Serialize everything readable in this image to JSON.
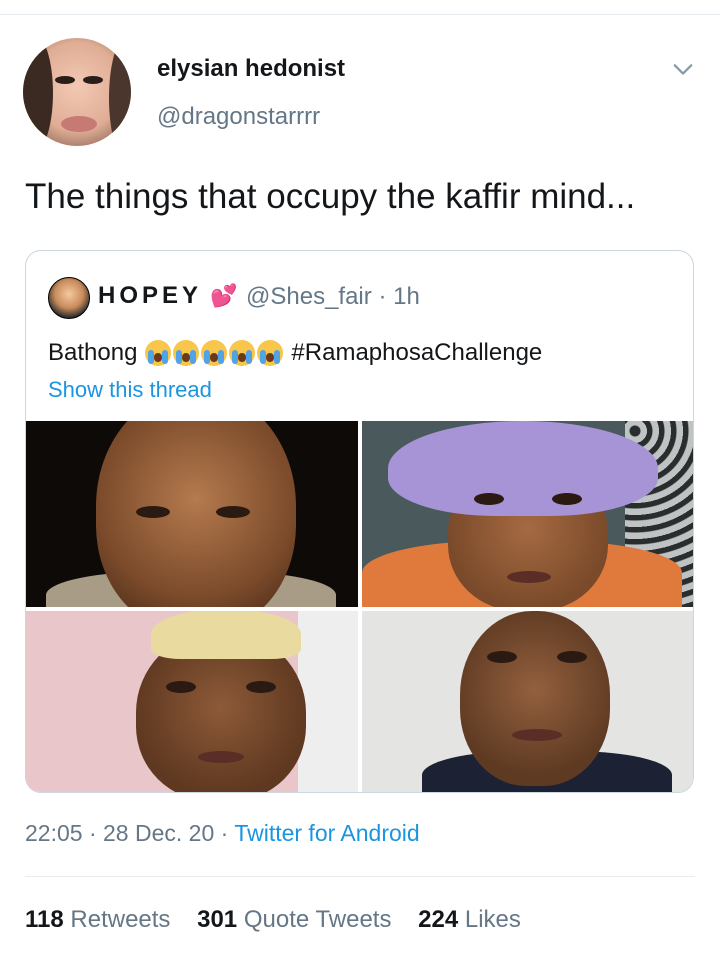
{
  "author": {
    "name": "elysian hedonist",
    "handle": "@dragonstarrrr"
  },
  "tweet": {
    "text": "The things that occupy the kaffir mind..."
  },
  "quoted": {
    "name": "HOPEY",
    "heart_emoji": "💕",
    "handle": "@Shes_fair",
    "separator": "·",
    "time": "1h",
    "text_before": "Bathong",
    "emoji_name": "loudly-crying-face",
    "emoji_count": 5,
    "hashtag": "#RamaphosaChallenge",
    "show_thread": "Show this thread",
    "photo_count": 4
  },
  "meta": {
    "time": "22:05",
    "sep1": "·",
    "date": "28 Dec. 20",
    "sep2": "·",
    "source": "Twitter for Android"
  },
  "stats": {
    "retweets_count": "118",
    "retweets_label": "Retweets",
    "quotes_count": "301",
    "quotes_label": "Quote Tweets",
    "likes_count": "224",
    "likes_label": "Likes"
  },
  "colors": {
    "link": "#1b95e0",
    "muted": "#657786",
    "text": "#14171a",
    "border": "#ccd6dd"
  },
  "icons": {
    "menu": "chevron-down-icon"
  }
}
